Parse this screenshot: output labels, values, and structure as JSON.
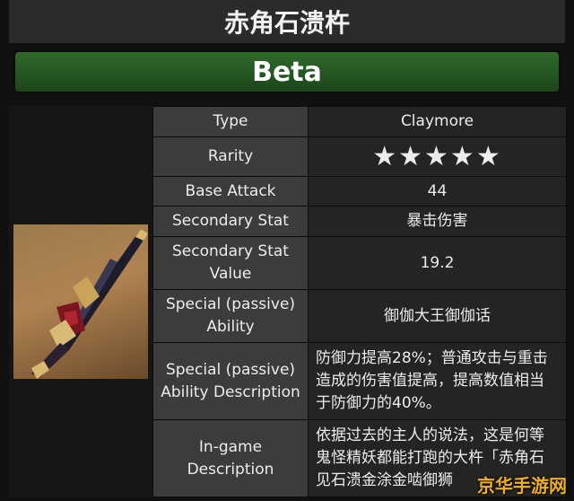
{
  "title": "赤角石溃杵",
  "banner": "Beta",
  "image": {
    "subject": "claymore-weapon-icon"
  },
  "rows": [
    {
      "label": "Type",
      "value": "Claymore",
      "accent": "#d8b250"
    },
    {
      "label": "Rarity",
      "value": "★★★★★",
      "stars": 5
    },
    {
      "label": "Base Attack",
      "value": "44"
    },
    {
      "label": "Secondary Stat",
      "value": "暴击伤害"
    },
    {
      "label": "Secondary Stat Value",
      "value": "19.2"
    },
    {
      "label": "Special (passive) Ability",
      "value": "御伽大王御伽话"
    },
    {
      "label": "Special (passive) Ability Description",
      "value": "防御力提高28%；普通攻击与重击造成的伤害值提高，提高数值相当于防御力的40%。"
    },
    {
      "label": "In-game Description",
      "value": "依据过去的主人的说法，这是何等鬼怪精妖都能打跑的大杵「赤角石见石溃金涂金啮御狮"
    }
  ],
  "watermark": "京华手游网",
  "colors": {
    "title_bg": "#2b2b2b",
    "banner": "#2e6a2a",
    "label_bg": "#3c3c3c",
    "value_bg": "#242424",
    "star": "#f6e100"
  }
}
